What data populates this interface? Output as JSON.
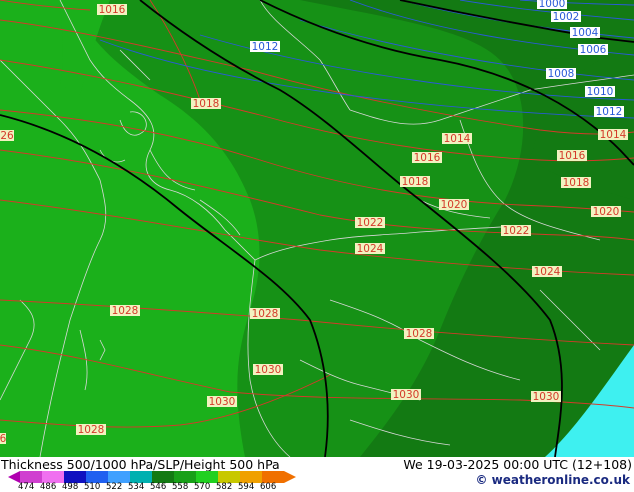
{
  "map": {
    "fill_colors": {
      "deep": "#137a13",
      "mid": "#169116",
      "light": "#1bb01b",
      "cyan": "#3ef0f0",
      "border": "#d8d8d8",
      "isobar": "#d43a2a",
      "isobar_low": "#2a5ad8",
      "height_line": "#000000"
    },
    "pressure_labels": [
      {
        "text": "1000",
        "kind": "low"
      },
      {
        "text": "1002",
        "kind": "low"
      },
      {
        "text": "1004",
        "kind": "low"
      },
      {
        "text": "1006",
        "kind": "low"
      },
      {
        "text": "1008",
        "kind": "low"
      },
      {
        "text": "1010",
        "kind": "low"
      },
      {
        "text": "1012",
        "kind": "low"
      },
      {
        "text": "1012",
        "kind": "low"
      },
      {
        "text": "1016",
        "kind": "high"
      },
      {
        "text": "1018",
        "kind": "high"
      },
      {
        "text": "1014",
        "kind": "high"
      },
      {
        "text": "1014",
        "kind": "high"
      },
      {
        "text": "1016",
        "kind": "high"
      },
      {
        "text": "1016",
        "kind": "high"
      },
      {
        "text": "1018",
        "kind": "high"
      },
      {
        "text": "1018",
        "kind": "high"
      },
      {
        "text": "1020",
        "kind": "high"
      },
      {
        "text": "1020",
        "kind": "high"
      },
      {
        "text": "1022",
        "kind": "high"
      },
      {
        "text": "1022",
        "kind": "high"
      },
      {
        "text": "1024",
        "kind": "high"
      },
      {
        "text": "1024",
        "kind": "high"
      },
      {
        "text": "1028",
        "kind": "high"
      },
      {
        "text": "1028",
        "kind": "high"
      },
      {
        "text": "1028",
        "kind": "high"
      },
      {
        "text": "1028",
        "kind": "high"
      },
      {
        "text": "1030",
        "kind": "high"
      },
      {
        "text": "1030",
        "kind": "high"
      },
      {
        "text": "1030",
        "kind": "high"
      },
      {
        "text": "1030",
        "kind": "high"
      },
      {
        "text": "26",
        "kind": "high"
      },
      {
        "text": "6",
        "kind": "high"
      }
    ]
  },
  "footer": {
    "title": "Thickness 500/1000 hPa/SLP/Height 500 hPa",
    "datetime": "We 19-03-2025 00:00 UTC (12+108)",
    "credit": "© weatheronline.co.uk",
    "scale_ticks": [
      "474",
      "486",
      "498",
      "510",
      "522",
      "534",
      "546",
      "558",
      "570",
      "582",
      "594",
      "606"
    ],
    "scale_colors": [
      "#b000b0",
      "#d040d0",
      "#f070f0",
      "#1010c0",
      "#2060f0",
      "#40a0ff",
      "#00b0b0",
      "#137a13",
      "#18a018",
      "#20d020",
      "#c8c800",
      "#f0a000",
      "#f07000"
    ]
  }
}
